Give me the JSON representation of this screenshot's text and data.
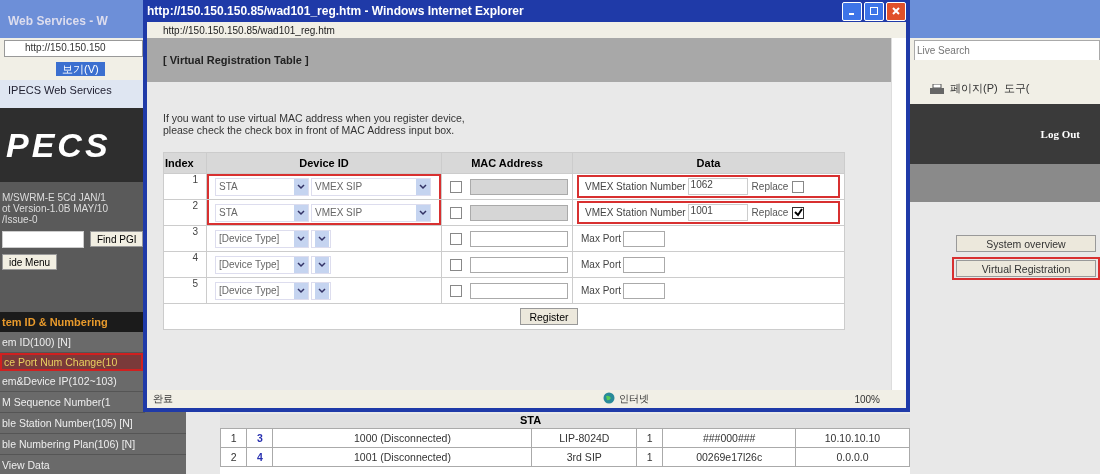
{
  "background_browser": {
    "title": "Web Services - W",
    "address": "http://150.150.150",
    "menu_item": {
      "label": "보기(V)",
      "selected": true
    },
    "tab": "IPECS Web Services",
    "search": {
      "placeholder": "Live Search"
    },
    "toolbar": [
      "페이지(P)",
      "도구("
    ],
    "logout": "Log Out"
  },
  "sidebar": {
    "logo": "PECS",
    "version_lines": [
      "M/SWRM-E 5Cd JAN/1",
      "ot Version-1.0B MAY/10",
      "/Issue-0"
    ],
    "find_button": "Find PGI",
    "menu_button": "ide Menu",
    "section": "tem ID & Numbering",
    "items": [
      {
        "label": "em ID(100) [N]",
        "selected": false
      },
      {
        "label": "ce Port Num Change(10",
        "selected": true
      },
      {
        "label": "em&Device IP(102~103)",
        "selected": false
      },
      {
        "label": "M Sequence Number(1",
        "selected": false
      },
      {
        "label": "ble Station Number(105) [N]",
        "selected": false
      },
      {
        "label": "ble Numbering Plan(106) [N]",
        "selected": false
      },
      {
        "label": "View Data",
        "selected": false
      }
    ]
  },
  "right_panel": {
    "buttons": [
      {
        "label": "System overview",
        "highlighted": false
      },
      {
        "label": "Virtual Registration",
        "highlighted": true
      }
    ]
  },
  "station_table": {
    "heading": "STA",
    "rows": [
      [
        "1",
        "3",
        "1000 (Disconnected)",
        "LIP-8024D",
        "1",
        "###000###",
        "10.10.10.10"
      ],
      [
        "2",
        "4",
        "1001 (Disconnected)",
        "3rd SIP",
        "1",
        "00269e17l26c",
        "0.0.0.0"
      ]
    ]
  },
  "popup": {
    "title": "http://150.150.150.85/wad101_reg.htm - Windows Internet Explorer",
    "address": "http://150.150.150.85/wad101_reg.htm",
    "heading": "[ Virtual Registration Table ]",
    "instructions": [
      "If you want to use virtual MAC address when you register device,",
      "please check the check box in front of MAC Address input box."
    ],
    "columns": [
      "Index",
      "Device ID",
      "MAC Address",
      "Data"
    ],
    "rows": [
      {
        "kind": "station",
        "index": "1",
        "device_type": "STA",
        "device": "VMEX SIP",
        "mac_checked": false,
        "data_label": "VMEX Station Number",
        "data_value": "1062",
        "replace_label": "Replace",
        "replace_checked": false,
        "highlighted": true
      },
      {
        "kind": "station",
        "index": "2",
        "device_type": "STA",
        "device": "VMEX SIP",
        "mac_checked": false,
        "data_label": "VMEX Station Number",
        "data_value": "1001",
        "replace_label": "Replace",
        "replace_checked": true,
        "highlighted": true
      },
      {
        "kind": "empty",
        "index": "3",
        "device_type": "[Device Type]",
        "mac_checked": false,
        "data_label": "Max Port"
      },
      {
        "kind": "empty",
        "index": "4",
        "device_type": "[Device Type]",
        "mac_checked": false,
        "data_label": "Max Port"
      },
      {
        "kind": "empty",
        "index": "5",
        "device_type": "[Device Type]",
        "mac_checked": false,
        "data_label": "Max Port"
      }
    ],
    "register_button": "Register",
    "status": {
      "left": "완료",
      "zone": "인터넷",
      "zoom": "100%"
    }
  }
}
